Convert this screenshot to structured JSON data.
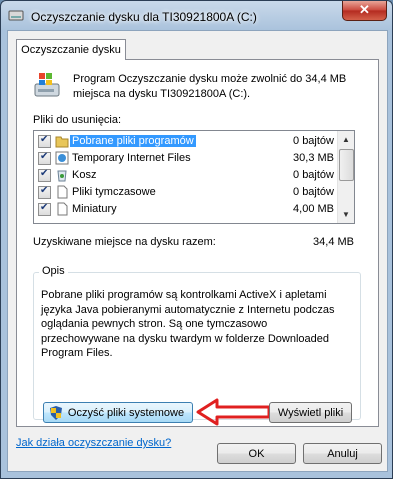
{
  "window": {
    "title": "Oczyszczanie dysku dla TI30921800A (C:)",
    "close_label": "✕"
  },
  "tab": {
    "label": "Oczyszczanie dysku"
  },
  "info": {
    "text": "Program Oczyszczanie dysku może zwolnić do 34,4 MB miejsca na dysku TI30921800A (C:)."
  },
  "files": {
    "label": "Pliki do usunięcia:",
    "items": [
      {
        "name": "Pobrane pliki programów",
        "size": "0 bajtów",
        "checked": true,
        "selected": true,
        "icon": "folder-icon"
      },
      {
        "name": "Temporary Internet Files",
        "size": "30,3 MB",
        "checked": true,
        "selected": false,
        "icon": "internet-icon"
      },
      {
        "name": "Kosz",
        "size": "0 bajtów",
        "checked": true,
        "selected": false,
        "icon": "recycle-bin-icon"
      },
      {
        "name": "Pliki tymczasowe",
        "size": "0 bajtów",
        "checked": true,
        "selected": false,
        "icon": "file-icon"
      },
      {
        "name": "Miniatury",
        "size": "4,00 MB",
        "checked": true,
        "selected": false,
        "icon": "file-icon"
      }
    ]
  },
  "total": {
    "label": "Uzyskiwane miejsce na dysku razem:",
    "value": "34,4 MB"
  },
  "description": {
    "legend": "Opis",
    "text": "Pobrane pliki programów są kontrolkami ActiveX i apletami języka Java pobieranymi automatycznie z Internetu podczas oglądania pewnych stron. Są one tymczasowo przechowywane na dysku twardym w folderze Downloaded Program Files."
  },
  "buttons": {
    "clean_system": "Oczyść pliki systemowe",
    "view_files": "Wyświetl pliki",
    "ok": "OK",
    "cancel": "Anuluj"
  },
  "help_link": "Jak działa oczyszczanie dysku?",
  "colors": {
    "selection": "#3399ff",
    "arrow": "#e02020",
    "link": "#0066cc"
  }
}
